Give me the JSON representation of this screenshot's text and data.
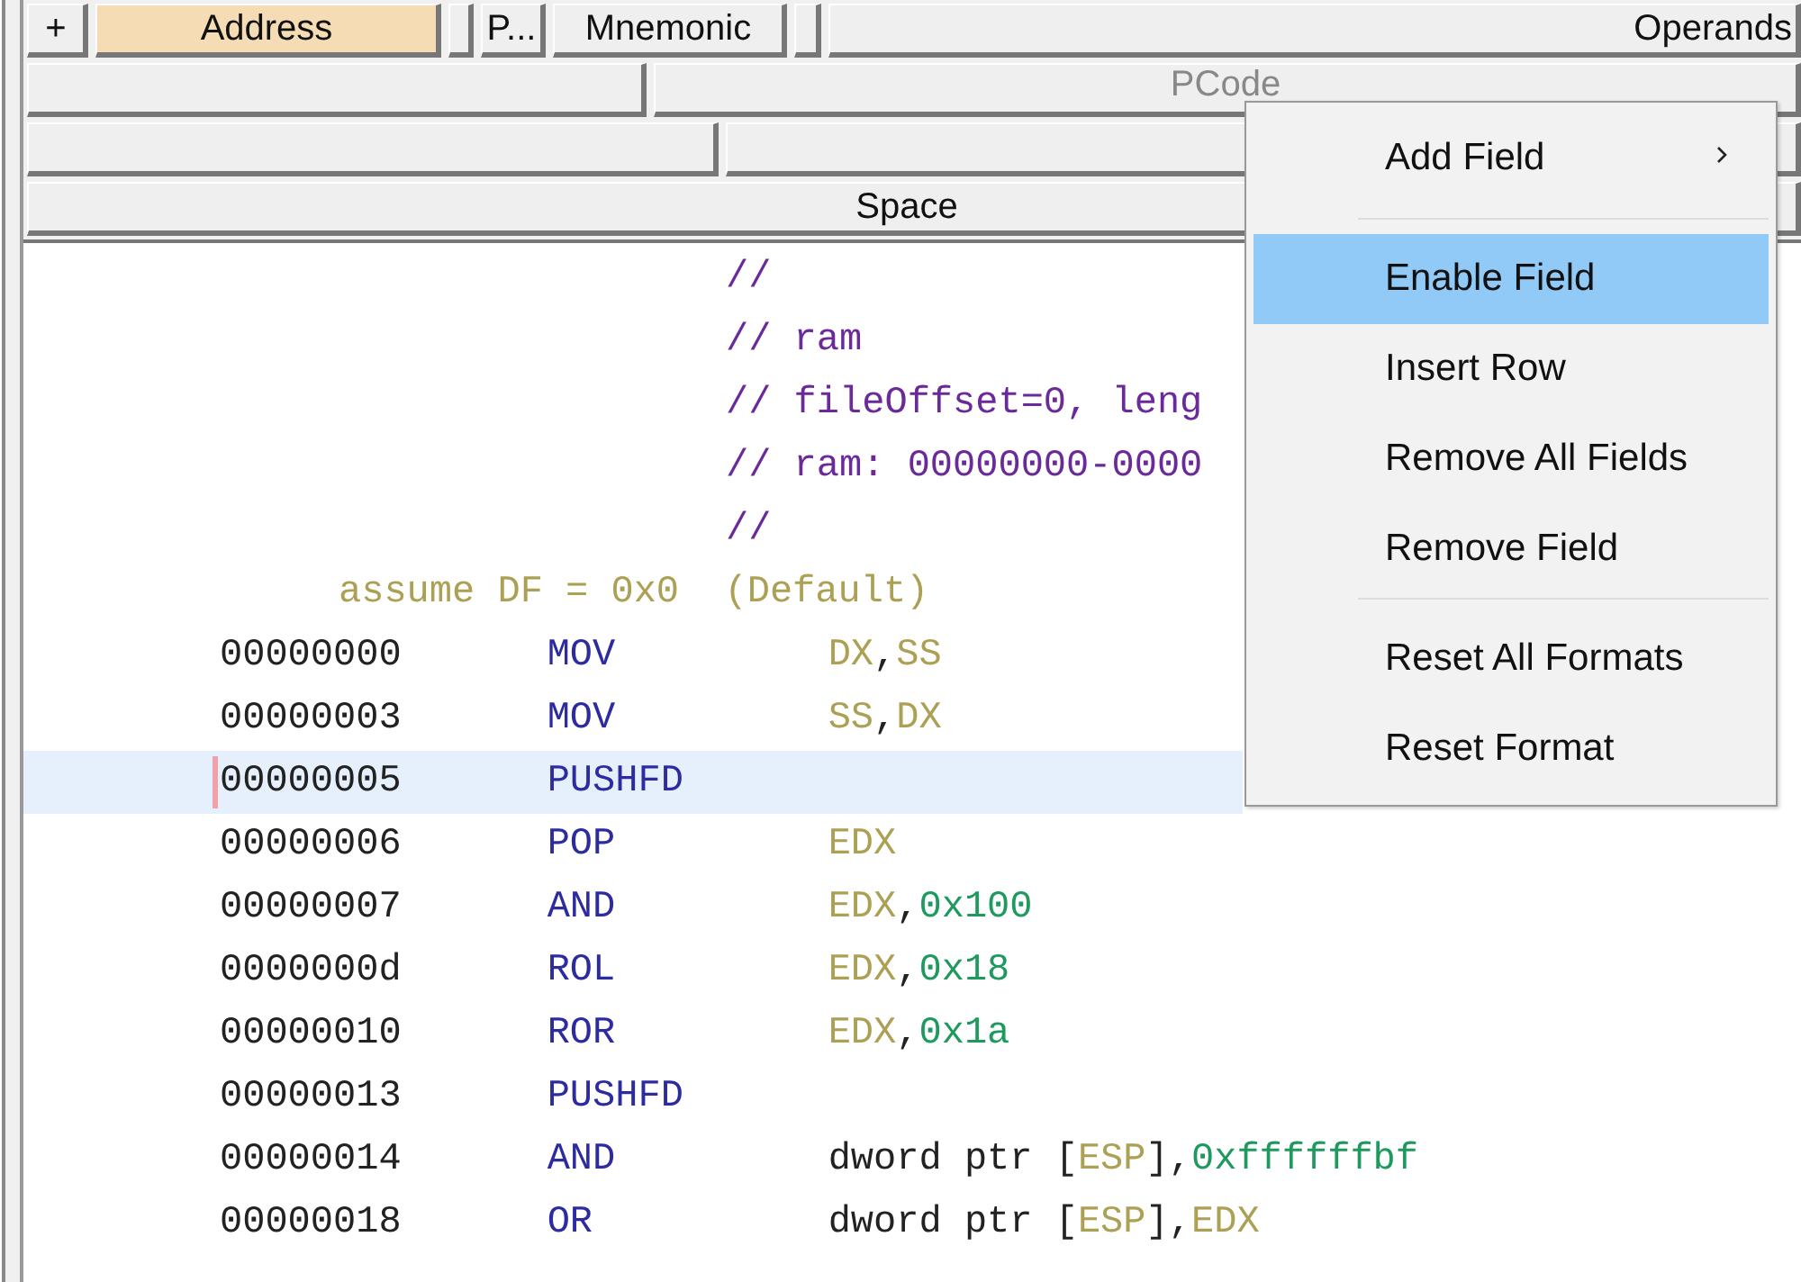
{
  "header_rows": [
    {
      "cells": [
        {
          "label": "+",
          "selected": false
        },
        {
          "label": "Address",
          "selected": true
        },
        {
          "selected": false
        },
        {
          "label": "P...",
          "selected": false
        },
        {
          "label": "Mnemonic",
          "selected": false
        },
        {
          "selected": false
        },
        {
          "label": "Operands",
          "selected": false
        }
      ]
    },
    {
      "cells": [
        {
          "selected": false
        },
        {
          "label": "PCode",
          "selected": false
        }
      ]
    },
    {
      "cells": [
        {
          "selected": false
        },
        {
          "selected": false
        }
      ]
    },
    {
      "cells": [
        {
          "label": "Space",
          "selected": false
        }
      ]
    }
  ],
  "listing": [
    {
      "kind": "comment",
      "text": "//",
      "selected": false
    },
    {
      "kind": "comment",
      "text": "// ram",
      "selected": false
    },
    {
      "kind": "comment",
      "text": "// fileOffset=0, leng",
      "selected": false
    },
    {
      "kind": "comment",
      "text": "// ram: 00000000-0000",
      "selected": false
    },
    {
      "kind": "comment",
      "text": "//",
      "selected": false
    },
    {
      "kind": "assume",
      "text": "assume DF = 0x0  (Default)",
      "selected": false
    },
    {
      "kind": "instruction",
      "address": "00000000",
      "mnemonic": "MOV",
      "operands": [
        {
          "kind": "register",
          "text": "DX"
        },
        {
          "kind": "plain",
          "text": ","
        },
        {
          "kind": "register",
          "text": "SS"
        }
      ],
      "selected": false
    },
    {
      "kind": "instruction",
      "address": "00000003",
      "mnemonic": "MOV",
      "operands": [
        {
          "kind": "register",
          "text": "SS"
        },
        {
          "kind": "plain",
          "text": ","
        },
        {
          "kind": "register",
          "text": "DX"
        }
      ],
      "selected": false
    },
    {
      "kind": "instruction",
      "address": "00000005",
      "mnemonic": "PUSHFD",
      "selected": true
    },
    {
      "kind": "instruction",
      "address": "00000006",
      "mnemonic": "POP",
      "operands": [
        {
          "kind": "register",
          "text": "EDX"
        }
      ],
      "selected": false
    },
    {
      "kind": "instruction",
      "address": "00000007",
      "mnemonic": "AND",
      "operands": [
        {
          "kind": "register",
          "text": "EDX"
        },
        {
          "kind": "plain",
          "text": ","
        },
        {
          "kind": "constant",
          "text": "0x100"
        }
      ],
      "selected": false
    },
    {
      "kind": "instruction",
      "address": "0000000d",
      "mnemonic": "ROL",
      "operands": [
        {
          "kind": "register",
          "text": "EDX"
        },
        {
          "kind": "plain",
          "text": ","
        },
        {
          "kind": "constant",
          "text": "0x18"
        }
      ],
      "selected": false
    },
    {
      "kind": "instruction",
      "address": "00000010",
      "mnemonic": "ROR",
      "operands": [
        {
          "kind": "register",
          "text": "EDX"
        },
        {
          "kind": "plain",
          "text": ","
        },
        {
          "kind": "constant",
          "text": "0x1a"
        }
      ],
      "selected": false
    },
    {
      "kind": "instruction",
      "address": "00000013",
      "mnemonic": "PUSHFD",
      "selected": false
    },
    {
      "kind": "instruction",
      "address": "00000014",
      "mnemonic": "AND",
      "operands": [
        {
          "kind": "plain",
          "text": "dword ptr ["
        },
        {
          "kind": "register",
          "text": "ESP"
        },
        {
          "kind": "plain",
          "text": "],"
        },
        {
          "kind": "constant",
          "text": "0xffffffbf"
        }
      ],
      "selected": false
    },
    {
      "kind": "instruction",
      "address": "00000018",
      "mnemonic": "OR",
      "operands": [
        {
          "kind": "plain",
          "text": "dword ptr ["
        },
        {
          "kind": "register",
          "text": "ESP"
        },
        {
          "kind": "plain",
          "text": "],"
        },
        {
          "kind": "register",
          "text": "EDX"
        }
      ],
      "selected": false
    }
  ],
  "context_menu": {
    "items": [
      {
        "kind": "submenu",
        "label": "Add Field",
        "selected": false
      },
      {
        "kind": "separator"
      },
      {
        "kind": "action",
        "label": "Enable Field",
        "selected": true
      },
      {
        "kind": "action",
        "label": "Insert Row",
        "selected": false
      },
      {
        "kind": "action",
        "label": "Remove All Fields",
        "selected": false
      },
      {
        "kind": "action",
        "label": "Remove Field",
        "selected": false
      },
      {
        "kind": "separator"
      },
      {
        "kind": "action",
        "label": "Reset All Formats",
        "selected": false
      },
      {
        "kind": "action",
        "label": "Reset Format",
        "selected": false
      }
    ]
  }
}
